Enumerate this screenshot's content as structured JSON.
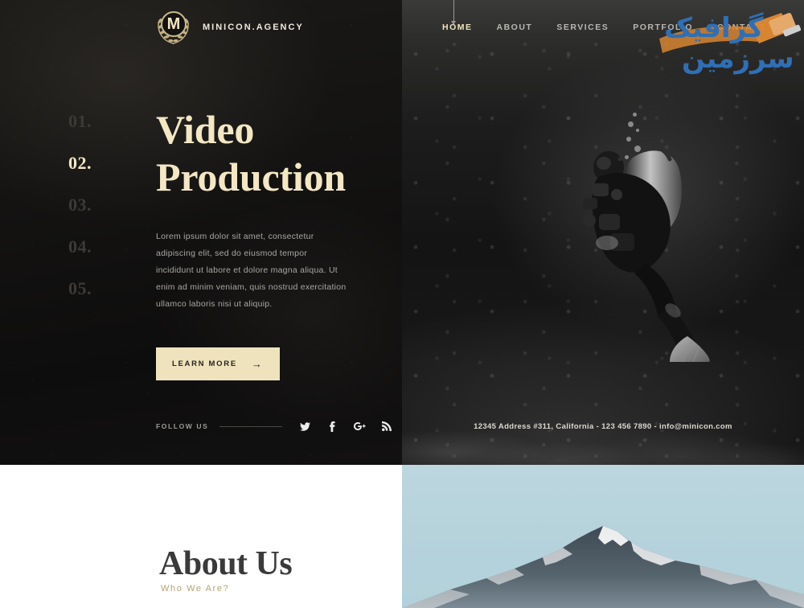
{
  "brand": {
    "logo_letter": "M",
    "logo_icon": "laurel-wreath-badge",
    "name": "MINICON.AGENCY",
    "accent_cream": "#efe3bd",
    "accent_gold": "#c9b98a",
    "dark_bg": "#141312"
  },
  "nav": {
    "items": [
      {
        "label": "HOME",
        "active": true
      },
      {
        "label": "ABOUT",
        "active": false
      },
      {
        "label": "SERVICES",
        "active": false
      },
      {
        "label": "PORTFOLIO",
        "active": false
      },
      {
        "label": "CONTACT",
        "active": false
      }
    ]
  },
  "slider": {
    "numbers": [
      {
        "label": "01.",
        "active": false
      },
      {
        "label": "02.",
        "active": true
      },
      {
        "label": "03.",
        "active": false
      },
      {
        "label": "04.",
        "active": false
      },
      {
        "label": "05.",
        "active": false
      }
    ]
  },
  "hero": {
    "title_line1": "Video",
    "title_line2": "Production",
    "body": "Lorem ipsum dolor sit amet, consectetur adipiscing elit, sed do eiusmod tempor incididunt ut labore et dolore magna aliqua. Ut enim ad minim veniam, quis nostrud exercitation ullamco laboris nisi ut aliquip.",
    "cta_label": "LEARN MORE",
    "cta_arrow": "→",
    "image_alt": "scuba-diver-underwater"
  },
  "follow": {
    "label": "FOLLOW US",
    "socials": [
      {
        "name": "twitter-icon",
        "glyph": "twitter"
      },
      {
        "name": "facebook-icon",
        "glyph": "f"
      },
      {
        "name": "google-plus-icon",
        "glyph": "g+"
      },
      {
        "name": "rss-icon",
        "glyph": "rss"
      }
    ]
  },
  "contact": {
    "text": "12345 Address #311, California  -  123 456 7890  -  info@minicon.com"
  },
  "about": {
    "title": "About Us",
    "subtitle": "Who We Are?",
    "image_alt": "snow-capped-mountain"
  },
  "watermark": {
    "text_top": "گرافیک",
    "text_bottom": "سرزمین",
    "icon": "paintbrush-icon",
    "color_blue": "#2f6fb5",
    "color_orange": "#e08a32"
  }
}
